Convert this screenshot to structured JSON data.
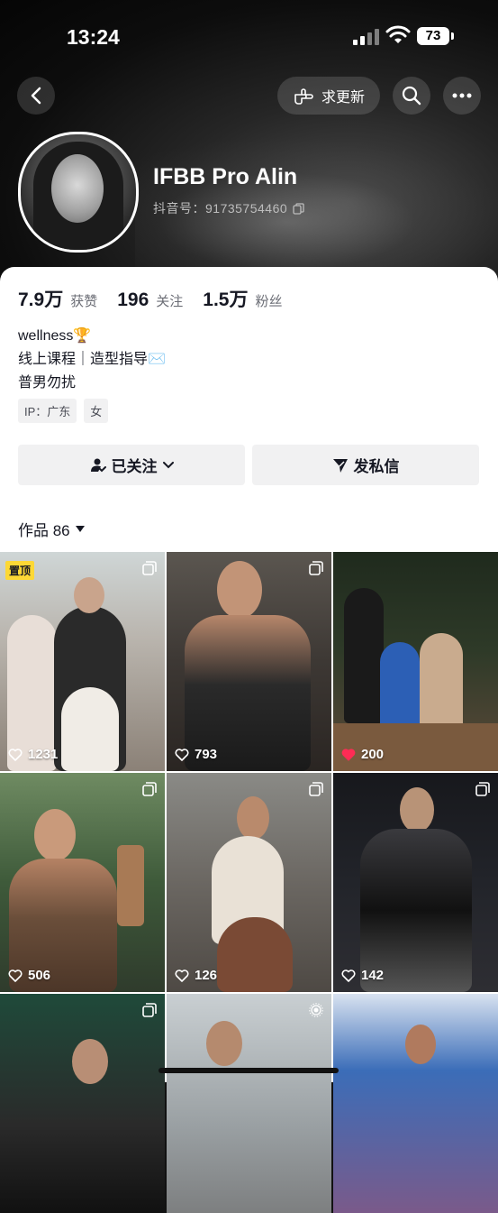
{
  "status_bar": {
    "time": "13:24",
    "battery": "73"
  },
  "top_nav": {
    "request_update_label": "求更新"
  },
  "profile": {
    "name": "IFBB Pro Alin",
    "douyin_id": "抖音号：91735754460"
  },
  "stats": {
    "likes_value": "7.9万",
    "likes_label": "获赞",
    "following_value": "196",
    "following_label": "关注",
    "followers_value": "1.5万",
    "followers_label": "粉丝"
  },
  "bio": {
    "line1": "wellness🏆",
    "line2": "线上课程｜造型指导✉️",
    "line3": "普男勿扰"
  },
  "tags": {
    "ip": "IP：广东",
    "gender": "女"
  },
  "actions": {
    "followed_label": "已关注",
    "message_label": "发私信"
  },
  "works": {
    "label": "作品 86"
  },
  "pinned_label": "置顶",
  "posts": [
    {
      "likes": "1231",
      "liked": false,
      "type": "multi"
    },
    {
      "likes": "793",
      "liked": false,
      "type": "multi"
    },
    {
      "likes": "200",
      "liked": true,
      "type": "none"
    },
    {
      "likes": "506",
      "liked": false,
      "type": "multi"
    },
    {
      "likes": "126",
      "liked": false,
      "type": "multi"
    },
    {
      "likes": "142",
      "liked": false,
      "type": "multi"
    },
    {
      "likes": "",
      "liked": false,
      "type": "multi"
    },
    {
      "likes": "",
      "liked": false,
      "type": "live"
    },
    {
      "likes": "",
      "liked": false,
      "type": "none"
    }
  ],
  "colors": {
    "accent_pin": "#fdd835",
    "heart_liked": "#fe2c55",
    "text_primary": "#161823"
  }
}
